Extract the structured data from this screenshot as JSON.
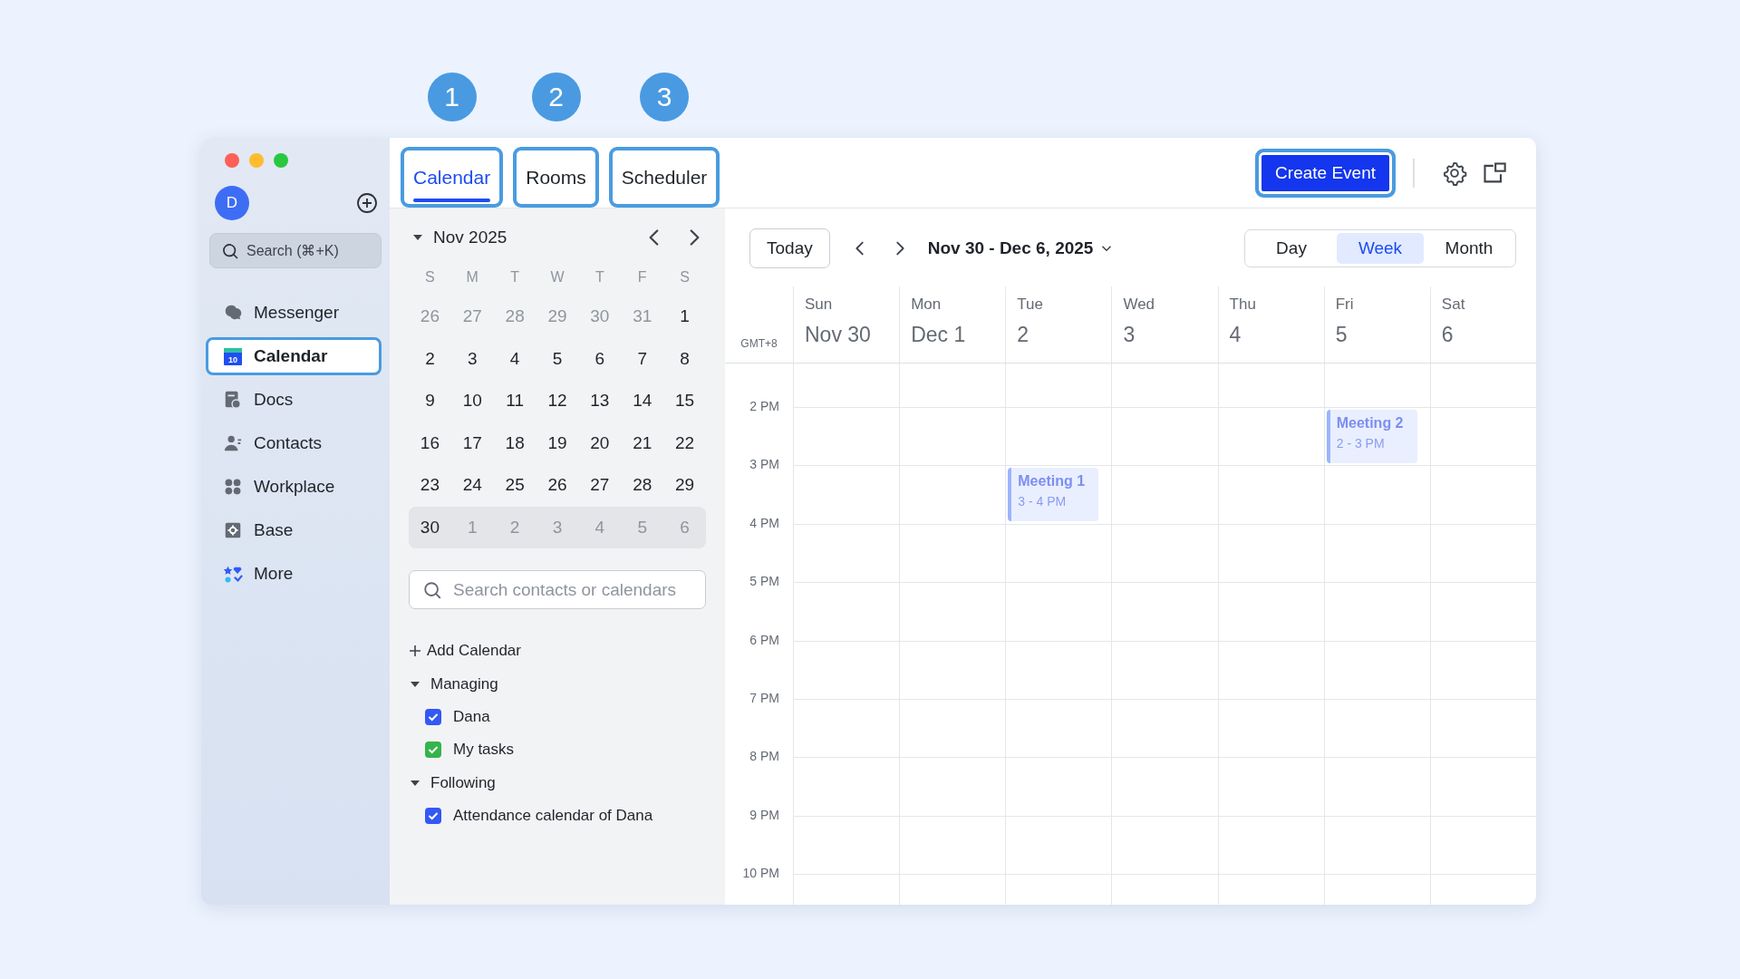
{
  "tabs": [
    {
      "label": "Calendar",
      "selected": true,
      "highlighted": true,
      "callout": "1"
    },
    {
      "label": "Rooms",
      "selected": false,
      "highlighted": true,
      "callout": "2"
    },
    {
      "label": "Scheduler",
      "selected": false,
      "highlighted": true,
      "callout": "3"
    }
  ],
  "sidebar": {
    "avatar": "D",
    "search": {
      "placeholder": "Search (⌘+K)"
    },
    "items": [
      {
        "label": "Messenger",
        "selected": false,
        "highlighted": false
      },
      {
        "label": "Calendar",
        "selected": true,
        "highlighted": true,
        "icon_label": "10"
      },
      {
        "label": "Docs",
        "selected": false,
        "highlighted": false
      },
      {
        "label": "Contacts",
        "selected": false,
        "highlighted": false
      },
      {
        "label": "Workplace",
        "selected": false,
        "highlighted": false
      },
      {
        "label": "Base",
        "selected": false,
        "highlighted": false
      },
      {
        "label": "More",
        "selected": false,
        "highlighted": false
      }
    ]
  },
  "create_button": {
    "label": "Create Event",
    "highlighted": true
  },
  "mini_calendar": {
    "month": "Nov 2025",
    "expanded": true,
    "weekdays": [
      "S",
      "M",
      "T",
      "W",
      "T",
      "F",
      "S"
    ],
    "weeks": [
      {
        "selected": false,
        "days": [
          {
            "day": "26",
            "muted": true
          },
          {
            "day": "27",
            "muted": true
          },
          {
            "day": "28",
            "muted": true
          },
          {
            "day": "29",
            "muted": true
          },
          {
            "day": "30",
            "muted": true
          },
          {
            "day": "31",
            "muted": true
          },
          {
            "day": "1",
            "muted": false
          }
        ]
      },
      {
        "selected": false,
        "days": [
          {
            "day": "2",
            "muted": false
          },
          {
            "day": "3",
            "muted": false
          },
          {
            "day": "4",
            "muted": false
          },
          {
            "day": "5",
            "muted": false
          },
          {
            "day": "6",
            "muted": false
          },
          {
            "day": "7",
            "muted": false
          },
          {
            "day": "8",
            "muted": false
          }
        ]
      },
      {
        "selected": false,
        "days": [
          {
            "day": "9",
            "muted": false
          },
          {
            "day": "10",
            "muted": false
          },
          {
            "day": "11",
            "muted": false
          },
          {
            "day": "12",
            "muted": false
          },
          {
            "day": "13",
            "muted": false
          },
          {
            "day": "14",
            "muted": false
          },
          {
            "day": "15",
            "muted": false
          }
        ]
      },
      {
        "selected": false,
        "days": [
          {
            "day": "16",
            "muted": false
          },
          {
            "day": "17",
            "muted": false
          },
          {
            "day": "18",
            "muted": false
          },
          {
            "day": "19",
            "muted": false
          },
          {
            "day": "20",
            "muted": false
          },
          {
            "day": "21",
            "muted": false
          },
          {
            "day": "22",
            "muted": false
          }
        ]
      },
      {
        "selected": false,
        "days": [
          {
            "day": "23",
            "muted": false
          },
          {
            "day": "24",
            "muted": false
          },
          {
            "day": "25",
            "muted": false
          },
          {
            "day": "26",
            "muted": false
          },
          {
            "day": "27",
            "muted": false
          },
          {
            "day": "28",
            "muted": false
          },
          {
            "day": "29",
            "muted": false
          }
        ]
      },
      {
        "selected": true,
        "days": [
          {
            "day": "30",
            "muted": false
          },
          {
            "day": "1",
            "muted": true
          },
          {
            "day": "2",
            "muted": true
          },
          {
            "day": "3",
            "muted": true
          },
          {
            "day": "4",
            "muted": true
          },
          {
            "day": "5",
            "muted": true
          },
          {
            "day": "6",
            "muted": true
          }
        ]
      }
    ]
  },
  "calendar_search": {
    "placeholder": "Search contacts or calendars"
  },
  "add_calendar": "Add Calendar",
  "calendar_groups": [
    {
      "label": "Managing",
      "expanded": true,
      "calendars": [
        {
          "name": "Dana",
          "checked": true,
          "color": "#3358f4"
        },
        {
          "name": "My tasks",
          "checked": true,
          "color": "#34b44a"
        }
      ]
    },
    {
      "label": "Following",
      "expanded": true,
      "calendars": [
        {
          "name": "Attendance calendar of Dana",
          "checked": true,
          "color": "#3358f4"
        }
      ]
    }
  ],
  "view_bar": {
    "today": "Today",
    "range": "Nov 30 - Dec 6, 2025",
    "views": [
      {
        "label": "Day",
        "selected": false
      },
      {
        "label": "Week",
        "selected": true
      },
      {
        "label": "Month",
        "selected": false
      }
    ]
  },
  "week": {
    "timezone": "GMT+8",
    "days": [
      {
        "weekday": "Sun",
        "date": "Nov 30"
      },
      {
        "weekday": "Mon",
        "date": "Dec 1"
      },
      {
        "weekday": "Tue",
        "date": "2"
      },
      {
        "weekday": "Wed",
        "date": "3"
      },
      {
        "weekday": "Thu",
        "date": "4"
      },
      {
        "weekday": "Fri",
        "date": "5"
      },
      {
        "weekday": "Sat",
        "date": "6"
      }
    ],
    "rows": [
      {
        "hour": "2 PM",
        "cells": [
          {
            "kind": "empty"
          },
          {
            "kind": "empty"
          },
          {
            "kind": "empty"
          },
          {
            "kind": "empty"
          },
          {
            "kind": "empty"
          },
          {
            "kind": "event",
            "title": "Meeting 2",
            "time": "2 - 3 PM"
          },
          {
            "kind": "empty"
          }
        ]
      },
      {
        "hour": "3 PM",
        "cells": [
          {
            "kind": "empty"
          },
          {
            "kind": "empty"
          },
          {
            "kind": "event",
            "title": "Meeting 1",
            "time": "3 - 4 PM"
          },
          {
            "kind": "empty"
          },
          {
            "kind": "empty"
          },
          {
            "kind": "empty"
          },
          {
            "kind": "empty"
          }
        ]
      },
      {
        "hour": "4 PM"
      },
      {
        "hour": "5 PM"
      },
      {
        "hour": "6 PM"
      },
      {
        "hour": "7 PM"
      },
      {
        "hour": "8 PM"
      },
      {
        "hour": "9 PM"
      },
      {
        "hour": "10 PM"
      }
    ]
  }
}
